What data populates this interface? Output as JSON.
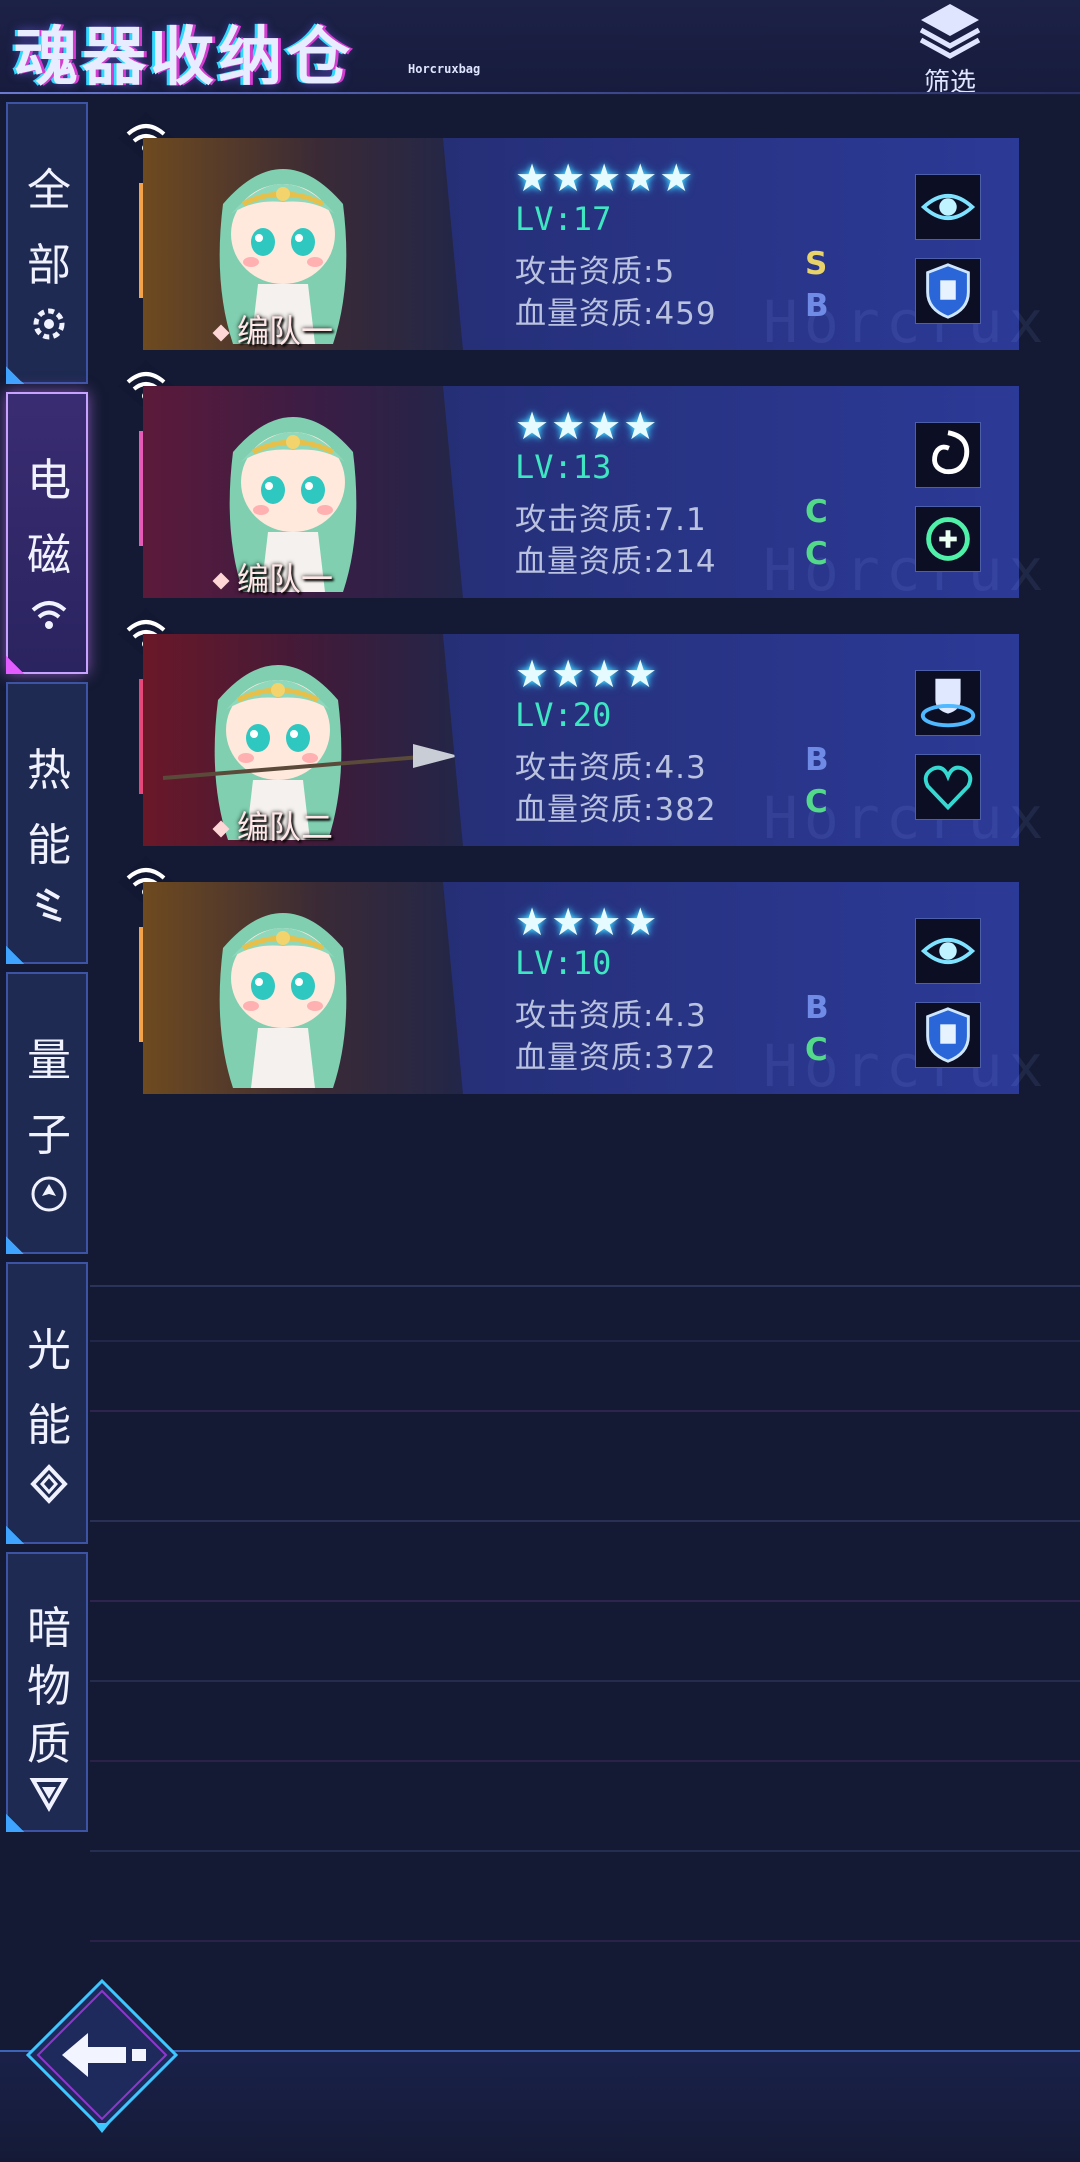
{
  "header": {
    "title": "魂器收纳仓",
    "subtitle": "Horcruxbag",
    "filter_label": "筛选"
  },
  "sidebar": {
    "items": [
      {
        "label": "全部",
        "chars": [
          "全",
          "部"
        ],
        "icon": "gear-icon",
        "active": false
      },
      {
        "label": "电磁",
        "chars": [
          "电",
          "磁"
        ],
        "icon": "wifi-icon",
        "active": true
      },
      {
        "label": "热能",
        "chars": [
          "热",
          "能"
        ],
        "icon": "heat-icon",
        "active": false
      },
      {
        "label": "量子",
        "chars": [
          "量",
          "子"
        ],
        "icon": "quantum-icon",
        "active": false
      },
      {
        "label": "光能",
        "chars": [
          "光",
          "能"
        ],
        "icon": "light-icon",
        "active": false
      },
      {
        "label": "暗物质",
        "chars": [
          "暗",
          "物",
          "质"
        ],
        "icon": "dark-matter-icon",
        "active": false
      }
    ]
  },
  "cards": [
    {
      "stars": "★★★★★",
      "star_count": 5,
      "lv": "LV:17",
      "attack": "攻击资质:5",
      "attack_grade": "S",
      "attack_grade_color": "#e8d36a",
      "hp": "血量资质:459",
      "hp_grade": "B",
      "hp_grade_color": "#6f8be6",
      "team": "编队一",
      "portrait_tone": "gold",
      "accent_color": "#f5a34a",
      "skills": [
        "eye-skill-icon",
        "shield-skill-icon"
      ]
    },
    {
      "stars": "★★★★",
      "star_count": 4,
      "lv": "LV:13",
      "attack": "攻击资质:7.1",
      "attack_grade": "C",
      "attack_grade_color": "#54d98a",
      "hp": "血量资质:214",
      "hp_grade": "C",
      "hp_grade_color": "#54d98a",
      "team": "编队一",
      "portrait_tone": "pink",
      "accent_color": "#e75ab5",
      "skills": [
        "vortex-skill-icon",
        "heal-skill-icon"
      ]
    },
    {
      "stars": "★★★★",
      "star_count": 4,
      "lv": "LV:20",
      "attack": "攻击资质:4.3",
      "attack_grade": "B",
      "attack_grade_color": "#6f8be6",
      "hp": "血量资质:382",
      "hp_grade": "C",
      "hp_grade_color": "#54d98a",
      "team": "编队二",
      "portrait_tone": "red",
      "accent_color": "#e7487a",
      "skills": [
        "guard-skill-icon",
        "heart-skill-icon"
      ]
    },
    {
      "stars": "★★★★",
      "star_count": 4,
      "lv": "LV:10",
      "attack": "攻击资质:4.3",
      "attack_grade": "B",
      "attack_grade_color": "#6f8be6",
      "hp": "血量资质:372",
      "hp_grade": "C",
      "hp_grade_color": "#54d98a",
      "team": "",
      "portrait_tone": "gold",
      "accent_color": "#f5a34a",
      "skills": [
        "eye-skill-icon",
        "shield-skill-icon"
      ]
    }
  ],
  "card_watermark": "Horcrux",
  "colors": {
    "background": "#141a33",
    "accent_cyan": "#3ee6c1",
    "active_tab": "#c7a2ff"
  }
}
